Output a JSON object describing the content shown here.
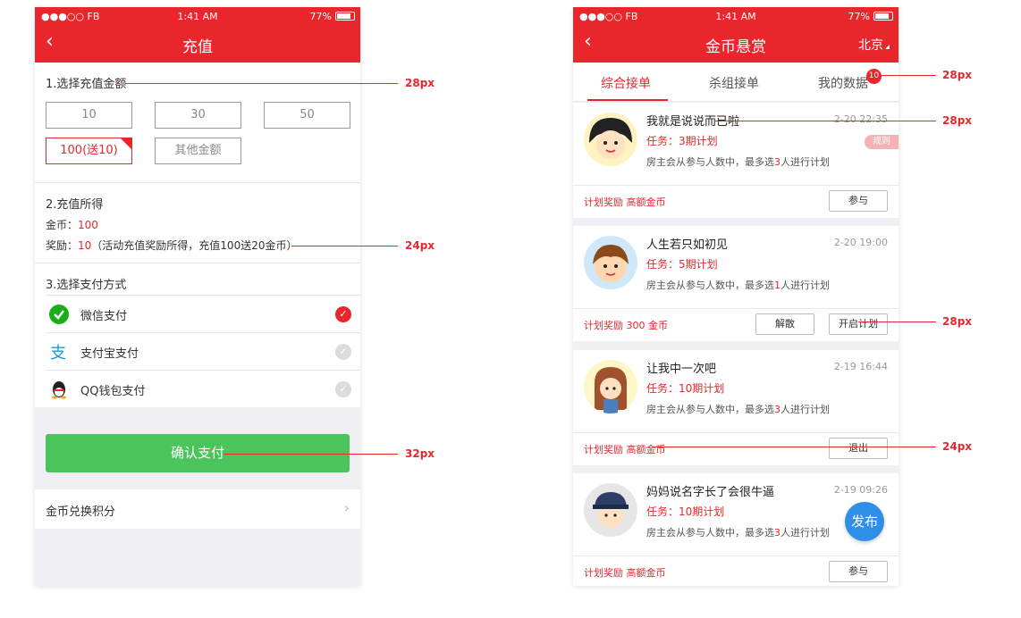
{
  "colors": {
    "brand_red": "#e8262c",
    "confirm_green": "#4cc45c",
    "fab_blue": "#2f8ee8"
  },
  "status_bar": {
    "carrier": "●●●○○ FB",
    "time": "1:41 AM",
    "battery": "77%"
  },
  "recharge": {
    "title": "充值",
    "back_icon": "chevron-left-icon",
    "step1_title": "1.选择充值金额",
    "amounts": [
      "10",
      "30",
      "50",
      "100(送10)",
      "其他金额"
    ],
    "selected_amount": "100(送10)",
    "step2_title": "2.充值所得",
    "coins_label": "金币：",
    "coins_value": "100",
    "bonus_label": "奖励：",
    "bonus_value": "10",
    "bonus_note": "（活动充值奖励所得，充值100送20金币）",
    "step3_title": "3.选择支付方式",
    "payments": [
      {
        "label": "微信支付",
        "icon": "wechat-icon",
        "selected": true
      },
      {
        "label": "支付宝支付",
        "icon": "alipay-icon",
        "selected": false
      },
      {
        "label": "QQ钱包支付",
        "icon": "qq-icon",
        "selected": false
      }
    ],
    "confirm_label": "确认支付",
    "exchange_label": "金币兑换积分"
  },
  "bounty": {
    "title": "金币悬赏",
    "city": "北京",
    "tabs": [
      "综合接单",
      "杀组接单",
      "我的数据"
    ],
    "active_tab": "综合接单",
    "badge_count": "10",
    "rule_tag": "规则",
    "fab_label": "发布",
    "cards": [
      {
        "name": "我就是说说而已啦",
        "time": "2-20 22:35",
        "task_label": "任务：",
        "task_value": "3期计划",
        "desc_a": "房主会从参与人数中，最多选",
        "desc_num": "3",
        "desc_b": "人进行计划",
        "reward": "计划奖励 高额金币",
        "buttons": [
          "参与"
        ]
      },
      {
        "name": "人生若只如初见",
        "time": "2-20 19:00",
        "task_label": "任务：",
        "task_value": "5期计划",
        "desc_a": "房主会从参与人数中，最多选",
        "desc_num": "1",
        "desc_b": "人进行计划",
        "reward": "计划奖励 300 金币",
        "buttons": [
          "解散",
          "开启计划"
        ]
      },
      {
        "name": "让我中一次吧",
        "time": "2-19 16:44",
        "task_label": "任务：",
        "task_value": "10期计划",
        "desc_a": "房主会从参与人数中，最多选",
        "desc_num": "3",
        "desc_b": "人进行计划",
        "reward": "计划奖励 高额金币",
        "buttons": [
          "退出"
        ]
      },
      {
        "name": "妈妈说名字长了会很牛逼",
        "time": "2-19 09:26",
        "task_label": "任务：",
        "task_value": "10期计划",
        "desc_a": "房主会从参与人数中，最多选",
        "desc_num": "3",
        "desc_b": "人进行计划",
        "reward": "计划奖励 高额金币",
        "buttons": [
          "参与"
        ]
      }
    ]
  },
  "annotations": [
    "28px",
    "24px",
    "32px",
    "28px",
    "28px",
    "28px",
    "24px"
  ]
}
